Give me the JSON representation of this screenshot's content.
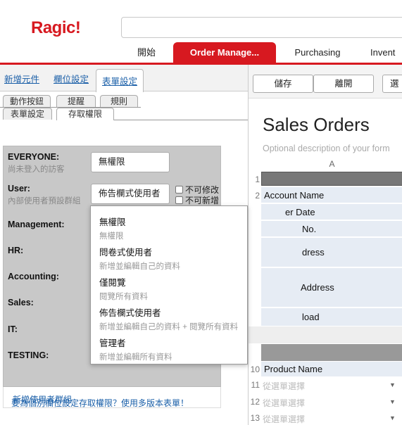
{
  "app": {
    "logo": "Ragic!",
    "nav": [
      {
        "label": "開始"
      },
      {
        "label": "Order Manage..."
      },
      {
        "label": "Purchasing"
      },
      {
        "label": "Invent"
      }
    ]
  },
  "left": {
    "top_tabs": [
      "新增元件",
      "欄位設定",
      "表單設定"
    ],
    "row1_tabs": [
      "動作按鈕",
      "提醒",
      "規則"
    ],
    "row2_tabs": [
      "表單設定",
      "存取權限"
    ],
    "groups": [
      {
        "name": "EVERYONE:",
        "sub": "尚未登入的訪客",
        "value": "無權限"
      },
      {
        "name": "User:",
        "sub": "內部使用者預設群組",
        "value": "佈告欄式使用者"
      },
      {
        "name": "Management:"
      },
      {
        "name": "HR:"
      },
      {
        "name": "Accounting:"
      },
      {
        "name": "Sales:"
      },
      {
        "name": "IT:"
      },
      {
        "name": "TESTING:"
      }
    ],
    "checkboxes": [
      "不可修改",
      "不可新增"
    ],
    "add_group": "新增使用者群組",
    "bottom_link": "要為個別欄位設定存取權限？使用多版本表單！"
  },
  "dropdown": [
    {
      "title": "無權限",
      "desc": "無權限"
    },
    {
      "title": "問卷式使用者",
      "desc": "新增並編輯自己的資料"
    },
    {
      "title": "僅閱覽",
      "desc": "閱覽所有資料"
    },
    {
      "title": "佈告欄式使用者",
      "desc": "新增並編輯自己的資料 + 閱覽所有資料"
    },
    {
      "title": "管理者",
      "desc": "新增並編輯所有資料"
    }
  ],
  "right": {
    "buttons": [
      "儲存",
      "離開",
      "選"
    ],
    "title": "Sales Orders",
    "description": "Optional description of your form",
    "column": "A",
    "rows": [
      {
        "num": "1",
        "text": ""
      },
      {
        "num": "2",
        "text": "Account Name"
      },
      {
        "num": "",
        "text": "er Date"
      },
      {
        "num": "",
        "text": "No."
      },
      {
        "num": "",
        "text": "dress"
      },
      {
        "num": "",
        "text": "Address"
      },
      {
        "num": "",
        "text": "load"
      },
      {
        "num": "10",
        "text": "Product Name"
      },
      {
        "num": "11",
        "text": "從選單選擇"
      },
      {
        "num": "12",
        "text": "從選單選擇"
      },
      {
        "num": "13",
        "text": "從選單選擇"
      }
    ],
    "colors": {
      "brand": "#d71920",
      "cell": "#e6ecf4"
    }
  }
}
